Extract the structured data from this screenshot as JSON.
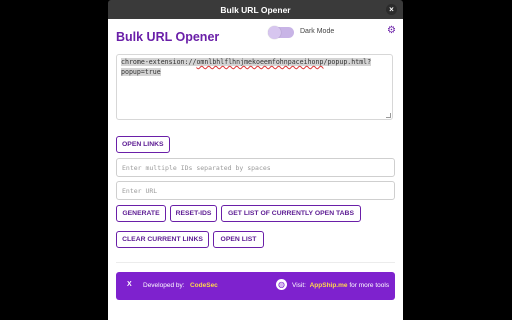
{
  "window": {
    "title": "Bulk URL Opener"
  },
  "header": {
    "title": "Bulk URL Opener",
    "dark_mode_label": "Dark Mode"
  },
  "urls": {
    "prefix": "chrome-extension://",
    "id": "omnlbhlflhnjmekoeemfohnpaceihonp",
    "suffix_line1": "/popup.html?",
    "line2": "popup=true"
  },
  "buttons": {
    "open_links": "OPEN LINKS",
    "generate": "GENERATE",
    "reset_ids": "RESET-IDS",
    "get_open_tabs": "GET LIST OF CURRENTLY OPEN TABS",
    "clear_current_links": "CLEAR CURRENT LINKS",
    "open_list": "OPEN LIST"
  },
  "inputs": {
    "ids_placeholder": "Enter multiple IDs separated by spaces",
    "url_placeholder": "Enter URL"
  },
  "footer": {
    "x_glyph": "X",
    "developed_label": "Developed by:",
    "developer": "CodeSec",
    "visit_label": "Visit:",
    "site": "AppShip.me",
    "more_tools": "for more tools"
  },
  "colors": {
    "accent": "#7e22ce",
    "highlight": "#ffd84a"
  },
  "icons": {
    "settings": "gear-icon",
    "globe": "globe-icon",
    "close": "close-icon"
  }
}
